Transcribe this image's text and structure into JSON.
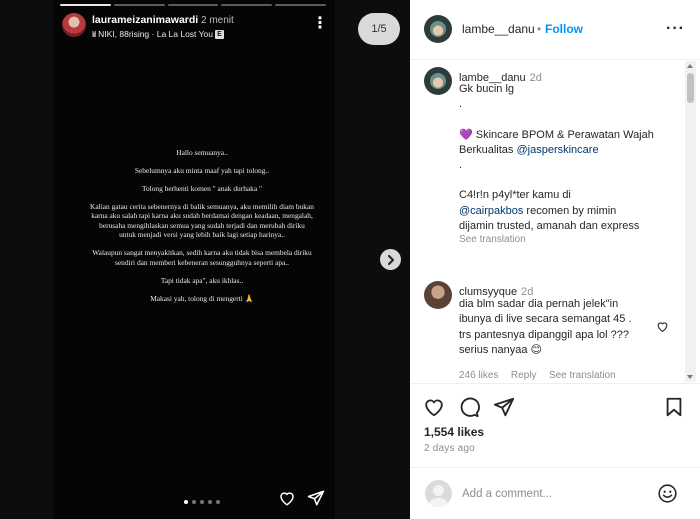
{
  "story": {
    "username": "laurameizanimawardi",
    "time": "2 menit",
    "music": "NIKI, 88rising · La La Lost You",
    "explicit": "E",
    "counter": "1/5",
    "progress_total": 5,
    "progress_current": 1,
    "text": [
      "Hallo semuanya..",
      "Sebelumnya aku minta maaf yah tapi tolong..",
      "Tolong berhenti komen \" anak durhaka \"",
      "Kalian gatau cerita sebenernya di balik semuanya, aku memilih diam bukan karna aku salah tapi karna aku sudah berdamai dengan keadaan, mengalah, berusaha mengihlaskan semua yang sudah terjadi dan merubah diriku untuk menjadi versi yang lebih baik lagi setiap harinya..",
      "Walaupun sangat menyakitkan, sedih karna aku tidak bisa membela diriku sendiri dan memberi kebeneran sesungguhnya seperti apa..",
      "Tapi tidak apa\", aku ikhlas..",
      "Makasi yah, tolong di mengerti 🙏"
    ]
  },
  "header": {
    "username": "lambe__danu",
    "separator": "•",
    "follow_label": "Follow",
    "more": "···"
  },
  "caption": {
    "username": "lambe__danu",
    "time": "2d",
    "lines": [
      "Gk bucin lg",
      ".",
      "",
      "💜  Skincare BPOM & Perawatan Wajah",
      "Berkualitas ",
      ".",
      "",
      "C4!r!n p4yl*ter kamu di",
      " recomen by mimin",
      "dijamin trusted, amanah dan express"
    ],
    "mention1": "@jasperskincare",
    "mention2": "@cairpakbos",
    "see_translation": "See translation"
  },
  "comment": {
    "username": "clumsyyque",
    "time": "2d",
    "lines": [
      "dia blm sadar dia pernah jelek\"in",
      "ibunya di live secara semangat 45 .",
      "trs pantesnya dipanggil apa lol ???",
      "serius nanyaa 😊"
    ],
    "likes": "246 likes",
    "reply": "Reply",
    "see_translation": "See translation"
  },
  "post": {
    "likes": "1,554 likes",
    "ago": "2 days ago"
  },
  "add_comment": {
    "placeholder": "Add a comment..."
  },
  "colors": {
    "link": "#0095f6",
    "mention": "#00376b",
    "muted": "#8e8e8e"
  }
}
